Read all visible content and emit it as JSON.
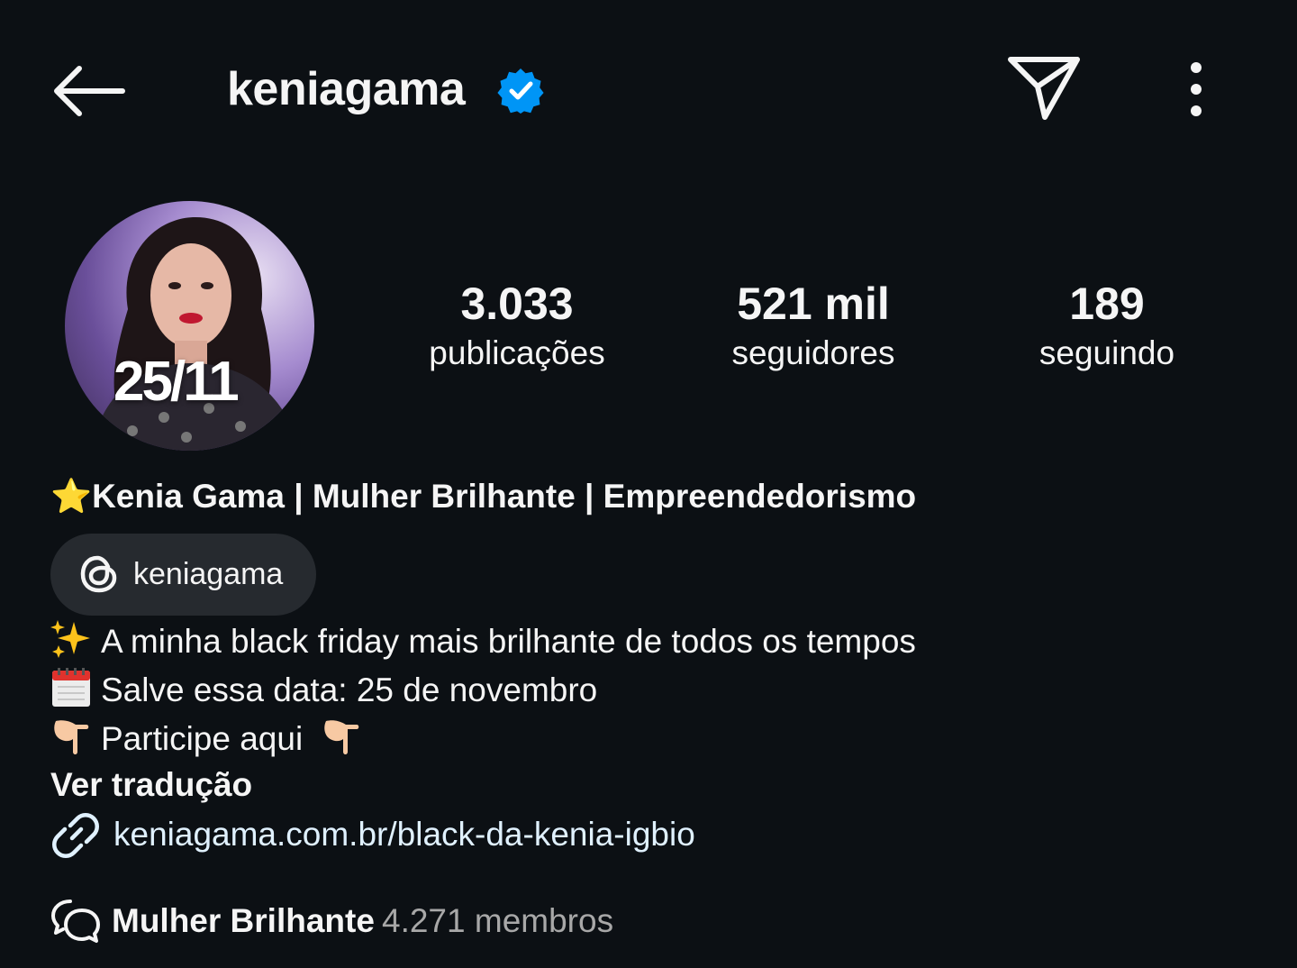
{
  "header": {
    "username": "keniagama",
    "back_icon": "arrow-left-icon",
    "verified_icon": "verified-badge-icon",
    "send_icon": "paper-plane-icon",
    "more_icon": "vertical-dots-icon"
  },
  "avatar": {
    "overlay_text": "25/11"
  },
  "stats": {
    "posts_value": "3.033",
    "posts_label": "publicações",
    "followers_value": "521 mil",
    "followers_label": "seguidores",
    "following_value": "189",
    "following_label": "seguindo"
  },
  "bio": {
    "name_line": "⭐Kenia Gama | Mulher Brilhante | Empreendedorismo",
    "threads_handle": "keniagama",
    "lines": [
      "A minha black friday mais brilhante de todos os tempos",
      "Salve essa data: 25 de novembro",
      "Participe aqui"
    ],
    "translate_label": "Ver tradução",
    "link_text": "keniagama.com.br/black-da-kenia-igbio"
  },
  "channel": {
    "name": "Mulher Brilhante",
    "members": "4.271 membros"
  },
  "colors": {
    "background": "#0c1014",
    "chip_background": "#262a2f",
    "verified": "#0095f6",
    "link": "#e0f1ff",
    "muted": "#a8a8a8"
  }
}
